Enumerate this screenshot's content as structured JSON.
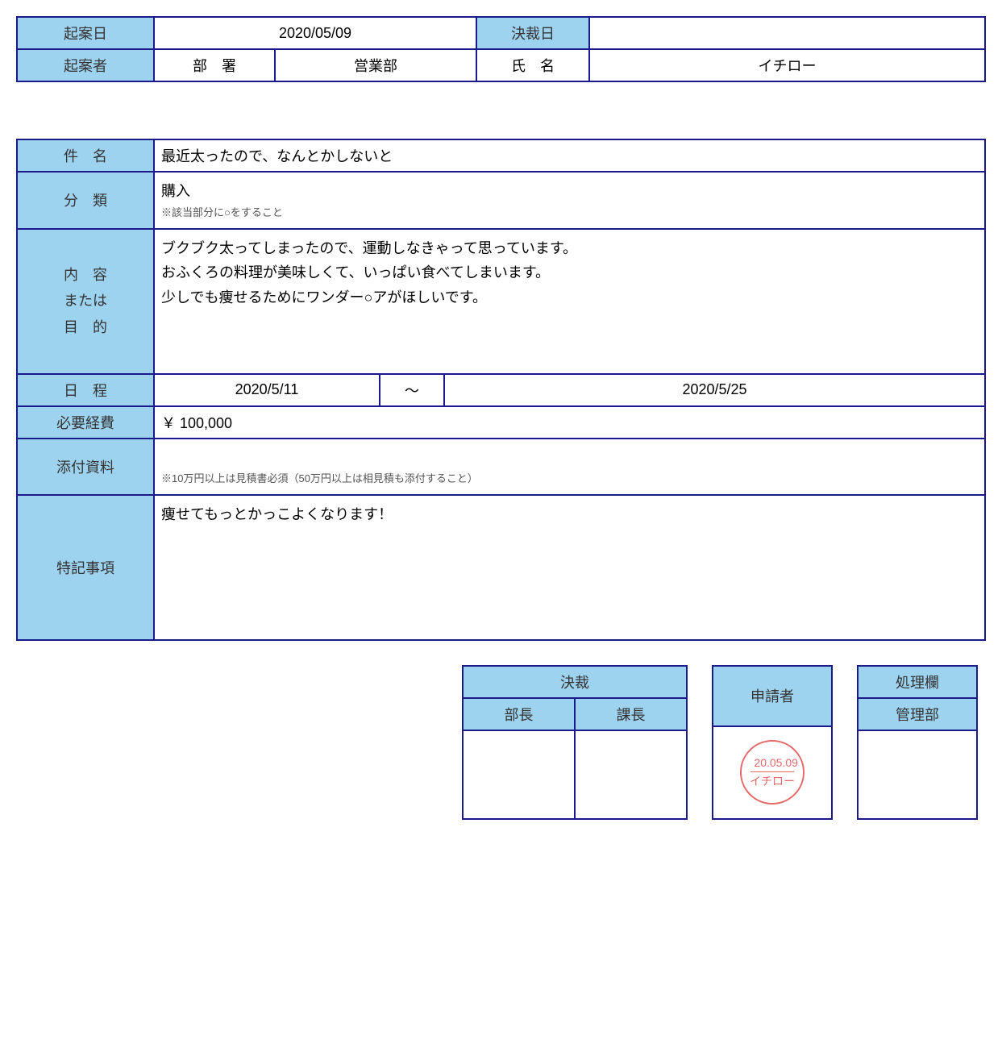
{
  "top": {
    "draft_date_label": "起案日",
    "draft_date_value": "2020/05/09",
    "decision_date_label": "決裁日",
    "decision_date_value": "",
    "drafter_label": "起案者",
    "dept_label": "部　署",
    "dept_value": "営業部",
    "name_label": "氏　名",
    "name_value": "イチロー"
  },
  "main": {
    "subject_label": "件　名",
    "subject_value": "最近太ったので、なんとかしないと",
    "category_label": "分　類",
    "category_value": "購入",
    "category_note": "※該当部分に○をすること",
    "content_label_line1": "内　容",
    "content_label_line2": "または",
    "content_label_line3": "目　的",
    "content_value": "ブクブク太ってしまったので、運動しなきゃって思っています。\nおふくろの料理が美味しくて、いっぱい食べてしまいます。\n少しでも痩せるためにワンダー○アがほしいです。",
    "schedule_label": "日　程",
    "schedule_from": "2020/5/11",
    "schedule_tilde": "〜",
    "schedule_to": "2020/5/25",
    "cost_label": "必要経費",
    "cost_value": "￥ 100,000",
    "attach_label": "添付資料",
    "attach_note": "※10万円以上は見積書必須（50万円以上は相見積も添付すること）",
    "remarks_label": "特記事項",
    "remarks_value": "痩せてもっとかっこよくなります！"
  },
  "approval": {
    "decision_header": "決裁",
    "bucho_label": "部長",
    "kacho_label": "課長",
    "applicant_header": "申請者",
    "stamp_date": "20.05.09",
    "stamp_name": "イチロー",
    "process_header": "処理欄",
    "kanri_label": "管理部"
  }
}
